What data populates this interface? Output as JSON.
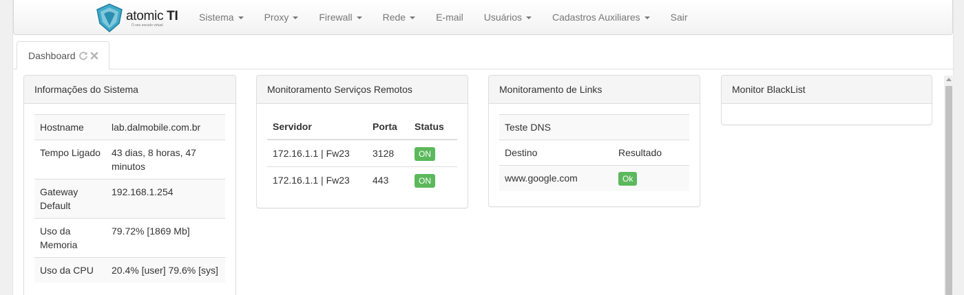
{
  "brand": {
    "name": "atomic",
    "name_bold": "TI",
    "tagline": "O seu escudo virtual"
  },
  "nav": {
    "items": [
      {
        "label": "Sistema",
        "dropdown": true
      },
      {
        "label": "Proxy",
        "dropdown": true
      },
      {
        "label": "Firewall",
        "dropdown": true
      },
      {
        "label": "Rede",
        "dropdown": true
      },
      {
        "label": "E-mail",
        "dropdown": false
      },
      {
        "label": "Usuários",
        "dropdown": true
      },
      {
        "label": "Cadastros Auxiliares",
        "dropdown": true
      },
      {
        "label": "Sair",
        "dropdown": false
      }
    ]
  },
  "tabs": [
    {
      "label": "Dashboard",
      "icons": [
        "refresh-icon",
        "close-icon"
      ]
    }
  ],
  "system_info": {
    "title": "Informações do Sistema",
    "rows": [
      {
        "label": "Hostname",
        "value": "lab.dalmobile.com.br"
      },
      {
        "label": "Tempo Ligado",
        "value": "43 dias, 8 horas, 47 minutos"
      },
      {
        "label": "Gateway Default",
        "value": "192.168.1.254"
      },
      {
        "label": "Uso da Memoria",
        "value": "79.72% [1869 Mb]"
      },
      {
        "label": "Uso da CPU",
        "value": "20.4% [user] 79.6% [sys]"
      }
    ]
  },
  "remote_services": {
    "title": "Monitoramento Serviços Remotos",
    "columns": [
      "Servidor",
      "Porta",
      "Status"
    ],
    "rows": [
      {
        "server": "172.16.1.1 | Fw23",
        "port": "3128",
        "status": "ON"
      },
      {
        "server": "172.16.1.1 | Fw23",
        "port": "443",
        "status": "ON"
      }
    ]
  },
  "links": {
    "title": "Monitoramento de Links",
    "test_title": "Teste DNS",
    "columns": [
      "Destino",
      "Resultado"
    ],
    "rows": [
      {
        "destination": "www.google.com",
        "result": "Ok"
      }
    ]
  },
  "blacklist": {
    "title": "Monitor BlackList"
  },
  "colors": {
    "success": "#5cb85c",
    "panel_heading": "#f5f5f5",
    "brand": "#3fa9c9"
  }
}
